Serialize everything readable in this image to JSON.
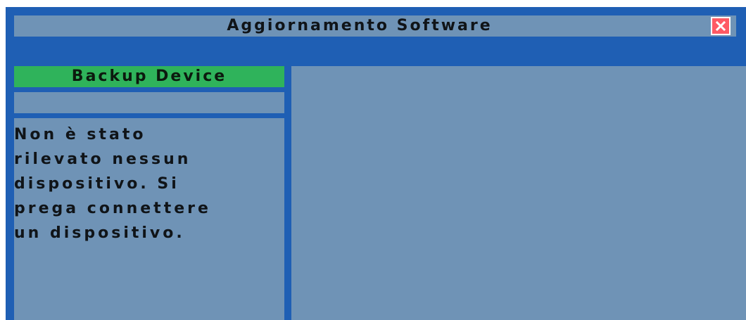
{
  "window": {
    "title": "Aggiornamento Software"
  },
  "close_button": {
    "icon": "close-icon",
    "color": "#ff5a64"
  },
  "left_panel": {
    "tab_label": "Backup Device",
    "tab_color": "#2fb35b",
    "message_lines": [
      "Non è stato",
      "rilevato nessun",
      "dispositivo. Si",
      "prega connettere",
      "un dispositivo."
    ]
  },
  "colors": {
    "frame": "#1f5fb4",
    "panel": "#6f93b6"
  }
}
